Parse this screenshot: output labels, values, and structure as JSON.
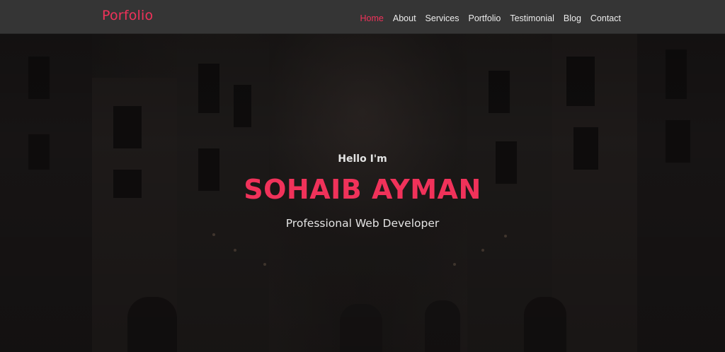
{
  "navbar": {
    "brand": "Porfolio",
    "items": [
      {
        "label": "Home",
        "active": true
      },
      {
        "label": "About",
        "active": false
      },
      {
        "label": "Services",
        "active": false
      },
      {
        "label": "Portfolio",
        "active": false
      },
      {
        "label": "Testimonial",
        "active": false
      },
      {
        "label": "Blog",
        "active": false
      },
      {
        "label": "Contact",
        "active": false
      }
    ]
  },
  "hero": {
    "greeting": "Hello I'm",
    "name": "SOHAIB AYMAN",
    "tagline": "Professional Web Developer"
  },
  "colors": {
    "accent": "#f0325a",
    "navbar_bg": "#353535",
    "text_light": "#e4e4e4"
  }
}
